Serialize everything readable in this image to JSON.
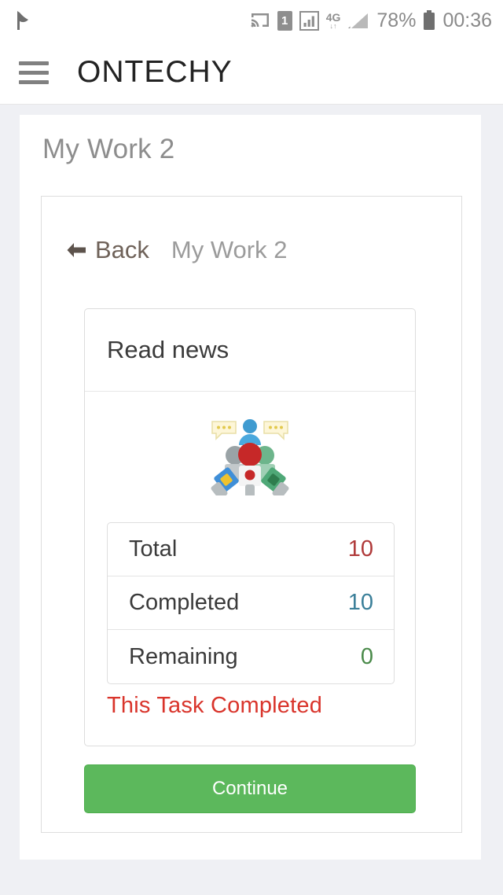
{
  "statusbar": {
    "left_icon": "flag-icon",
    "icons": [
      "cast-icon",
      "sim-1-icon",
      "signal-bars-icon",
      "network-4g-icon",
      "signal-triangle-icon"
    ],
    "sim_label": "1",
    "network_label": "4G",
    "network_arrows": "↓↑",
    "battery_percent": "78%",
    "battery_icon": "battery-icon",
    "clock": "00:36"
  },
  "appbar": {
    "menu_icon": "hamburger-menu-icon",
    "title": "ONTECHY"
  },
  "page": {
    "title": "My Work 2"
  },
  "breadcrumb": {
    "back_icon": "arrow-left-icon",
    "back_label": "Back",
    "current": "My Work 2"
  },
  "task": {
    "title": "Read news",
    "illustration": "people-speech-bubbles-icon",
    "status_message": "This Task Completed",
    "status_color": "#d9342b",
    "stats": [
      {
        "label": "Total",
        "value": "10",
        "color": "#b03a3a"
      },
      {
        "label": "Completed",
        "value": "10",
        "color": "#3a7f99"
      },
      {
        "label": "Remaining",
        "value": "0",
        "color": "#4a8a4a"
      }
    ]
  },
  "actions": {
    "continue_label": "Continue",
    "continue_color": "#5cb85c"
  }
}
